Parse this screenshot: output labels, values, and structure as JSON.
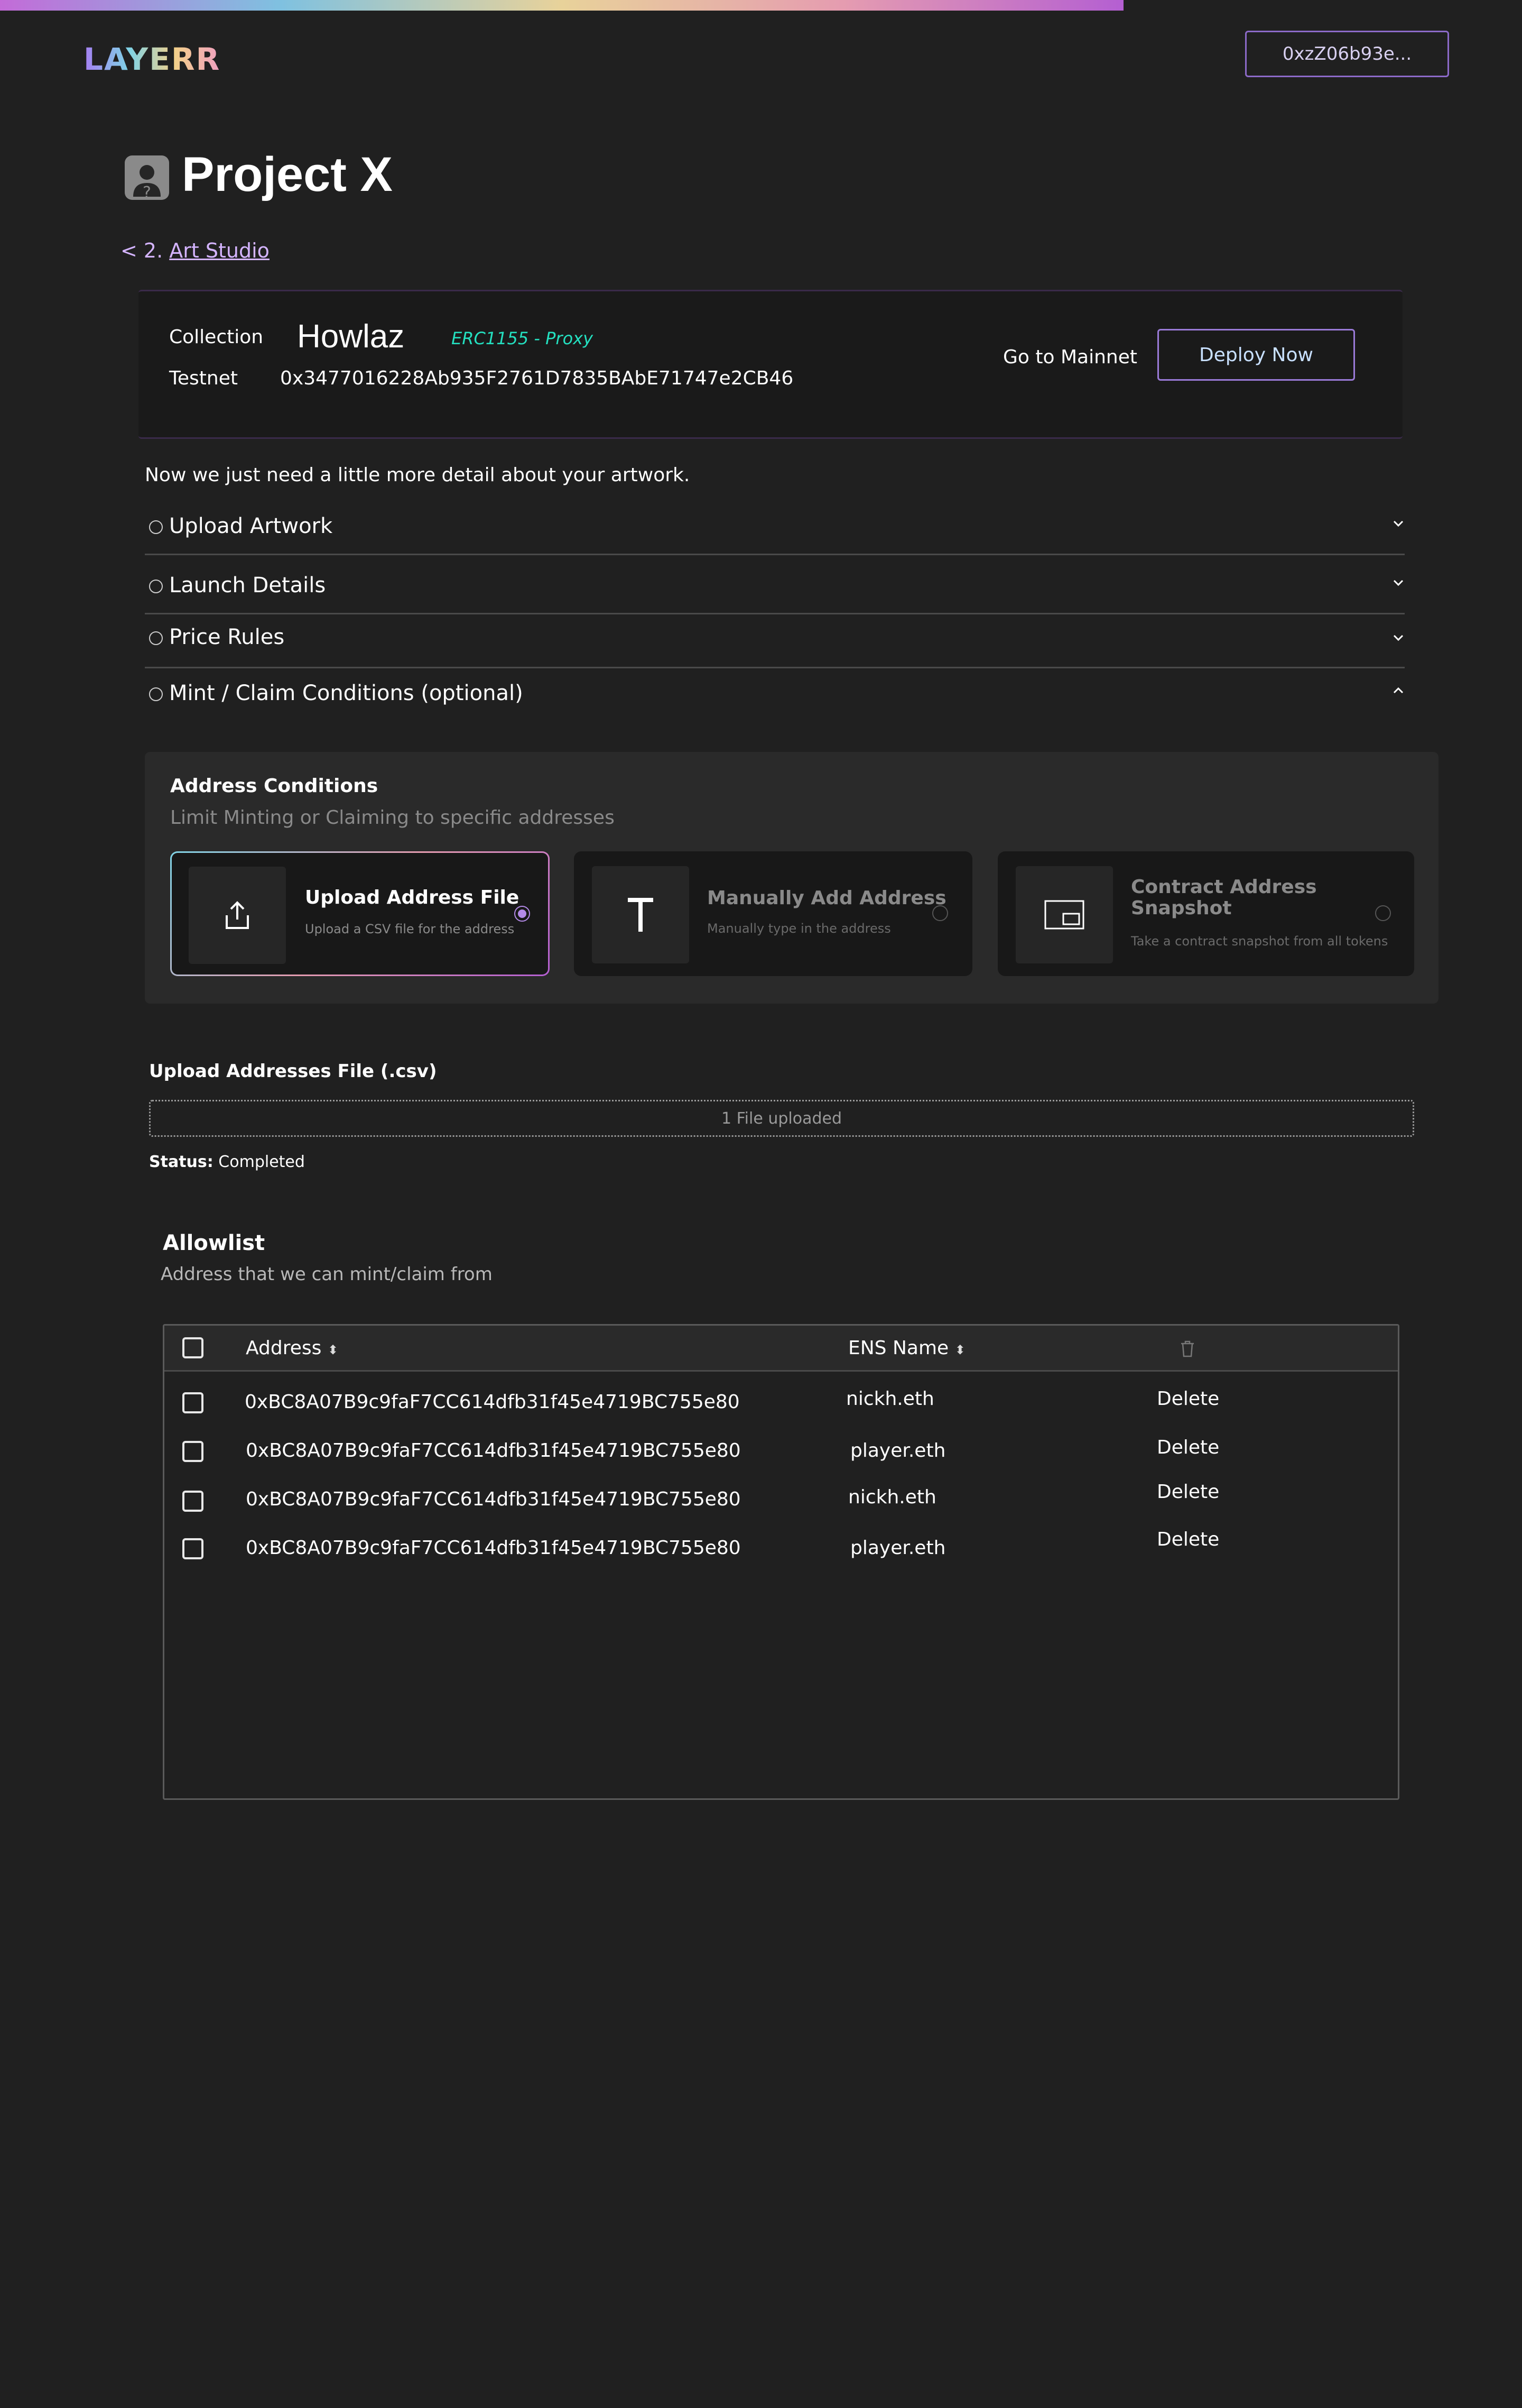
{
  "brand": {
    "logo": "LAYERR",
    "wallet": "0xzZ06b93e..."
  },
  "project": {
    "title": "Project X",
    "breadcrumb_prefix": "< 2.",
    "breadcrumb_link": "Art Studio"
  },
  "collection": {
    "label": "Collection",
    "name": "Howlaz",
    "standard": "ERC1155 - Proxy",
    "network_label": "Testnet",
    "address": "0x3477016228Ab935F2761D7835BAbE71747e2CB46",
    "mainnet_link": "Go to Mainnet",
    "deploy_label": "Deploy Now"
  },
  "intro": "Now we just need a little more detail about your artwork.",
  "accordion": [
    {
      "label": "Upload Artwork",
      "expanded": false
    },
    {
      "label": "Launch Details",
      "expanded": false
    },
    {
      "label": "Price Rules",
      "expanded": false
    },
    {
      "label": "Mint / Claim Conditions (optional)",
      "expanded": true
    }
  ],
  "address_conditions": {
    "title": "Address Conditions",
    "subtitle": "Limit Minting or Claiming to specific addresses",
    "options": [
      {
        "title": "Upload Address File",
        "desc": "Upload a CSV file for the address",
        "icon": "upload-icon",
        "selected": true
      },
      {
        "title": "Manually Add Address",
        "desc": "Manually type in the address",
        "icon": "text-t-icon",
        "selected": false
      },
      {
        "title": "Contract Address Snapshot",
        "desc": "Take a contract snapshot from all tokens",
        "icon": "snapshot-icon",
        "selected": false
      }
    ]
  },
  "upload": {
    "title": "Upload Addresses File (.csv)",
    "dropzone": "1 File uploaded",
    "status_label": "Status:",
    "status_value": "Completed"
  },
  "allowlist": {
    "title": "Allowlist",
    "subtitle": "Address that we can mint/claim from",
    "columns": {
      "address": "Address",
      "ens": "ENS Name"
    },
    "rows": [
      {
        "address": "0xBC8A07B9c9faF7CC614dfb31f45e4719BC755e80",
        "ens": "nickh.eth",
        "action": "Delete"
      },
      {
        "address": "0xBC8A07B9c9faF7CC614dfb31f45e4719BC755e80",
        "ens": "player.eth",
        "action": "Delete"
      },
      {
        "address": "0xBC8A07B9c9faF7CC614dfb31f45e4719BC755e80",
        "ens": "nickh.eth",
        "action": "Delete"
      },
      {
        "address": "0xBC8A07B9c9faF7CC614dfb31f45e4719BC755e80",
        "ens": "player.eth",
        "action": "Delete"
      }
    ]
  },
  "colors": {
    "background": "#202020",
    "accent": "#9a7ad8",
    "erc": "#24e0c0"
  }
}
